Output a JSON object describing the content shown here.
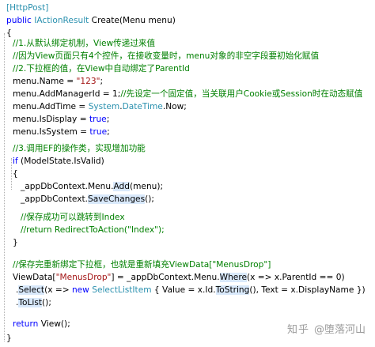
{
  "code": {
    "l01": {
      "attr": "[HttpPost]"
    },
    "l02": {
      "kw": "public",
      "type": "IActionResult",
      "method": "Create",
      "params": "(Menu menu)"
    },
    "l03": {
      "text": "{"
    },
    "l04": {
      "comment": "//1.从默认绑定机制，View传递过来值"
    },
    "l05": {
      "comment": "//因为View页面只有4个控件，在接收变量时，menu对象的非空字段要初始化赋值"
    },
    "l06": {
      "comment": "//2.下拉框的值，在View中自动绑定了ParentId"
    },
    "l07": {
      "pre": "menu.Name = ",
      "str": "\"123\"",
      "post": ";"
    },
    "l08": {
      "pre": "menu.AddManagerId = 1;",
      "comment": "//先设定一个固定值，当关联用户Cookie或Session时在动态赋值"
    },
    "l09": {
      "pre": "menu.AddTime = ",
      "type1": "System",
      "dot": ".",
      "type2": "DateTime",
      "post": ".Now;"
    },
    "l10": {
      "pre": "menu.IsDisplay = ",
      "kw": "true",
      "post": ";"
    },
    "l11": {
      "pre": "menu.IsSystem = ",
      "kw": "true",
      "post": ";"
    },
    "l12": {
      "comment": "//3.调用EF的操作类，实现增加功能"
    },
    "l13": {
      "kw": "if",
      "post": " (ModelState.IsValid)"
    },
    "l14": {
      "text": "{"
    },
    "l15": {
      "pre": "_appDbContext.Menu.",
      "method": "Add",
      "post": "(menu);"
    },
    "l16": {
      "pre": "_appDbContext.",
      "method": "SaveChanges",
      "post": "();"
    },
    "l17": {
      "comment": "//保存成功可以跳转到Index"
    },
    "l18": {
      "comment": "//return RedirectToAction(\"Index\");"
    },
    "l19": {
      "text": "}"
    },
    "l20": {
      "comment": "//保存完重新绑定下拉框，也就是重新填充ViewData[\"MenusDrop\"]"
    },
    "l21": {
      "pre": "ViewData[",
      "str": "\"MenusDrop\"",
      "mid": "] = _appDbContext.Menu.",
      "method": "Where",
      "post": "(x => x.ParentId == 0)"
    },
    "l22": {
      "pre": ".",
      "method": "Select",
      "mid": "(x => ",
      "kw": "new",
      "type": "SelectListItem",
      "post1": " { Value = x.Id.",
      "method2": "ToString",
      "post2": "(), Text = x.DisplayName })"
    },
    "l23": {
      "pre": ".",
      "method": "ToList",
      "post": "();"
    },
    "l24": {
      "kw": "return",
      "method": "View",
      "post": "();"
    },
    "l25": {
      "text": "}"
    }
  },
  "watermark": {
    "site": "知乎",
    "author": "@堕落河山"
  },
  "colors": {
    "keyword": "#0000ff",
    "type": "#2b91af",
    "comment": "#008000",
    "string": "#a31515",
    "text": "#000000",
    "highlight": "#d9e9fb",
    "watermark": "#9b9b9b"
  }
}
